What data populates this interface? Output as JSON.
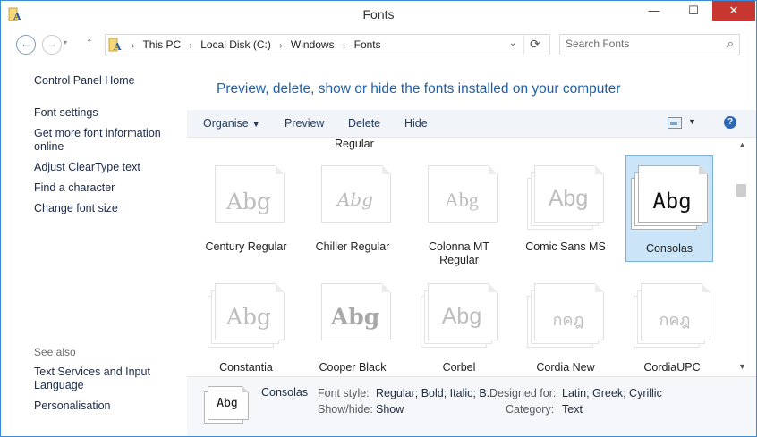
{
  "window": {
    "title": "Fonts",
    "min": "—",
    "max": "☐",
    "close": "✕"
  },
  "nav": {
    "back": "←",
    "forward": "→",
    "up": "↑",
    "history": "▾"
  },
  "address": {
    "crumbs": [
      "This PC",
      "Local Disk (C:)",
      "Windows",
      "Fonts"
    ],
    "separator": "›",
    "dropdown": "⌄",
    "refresh": "⟳"
  },
  "search": {
    "placeholder": "Search Fonts",
    "icon": "⌕"
  },
  "sidebar": {
    "links": [
      "Control Panel Home",
      "Font settings",
      "Get more font information online",
      "Adjust ClearType text",
      "Find a character",
      "Change font size"
    ],
    "see_also": "See also",
    "see_also_links": [
      "Text Services and Input Language",
      "Personalisation"
    ]
  },
  "heading": "Preview, delete, show or hide the fonts installed on your computer",
  "toolbar": {
    "organise": "Organise",
    "preview": "Preview",
    "delete": "Delete",
    "hide": "Hide",
    "caret": "▼",
    "help": "?"
  },
  "partial_label": "Regular",
  "fonts_row1": [
    {
      "name": "Century Regular",
      "sample": "Abg"
    },
    {
      "name": "Chiller Regular",
      "sample": "Abg"
    },
    {
      "name": "Colonna MT Regular",
      "sample": "Abg"
    },
    {
      "name": "Comic Sans MS",
      "sample": "Abg"
    },
    {
      "name": "Consolas",
      "sample": "Abg"
    }
  ],
  "fonts_row2": [
    {
      "name": "Constantia",
      "sample": "Abg"
    },
    {
      "name": "Cooper Black",
      "sample": "Abg"
    },
    {
      "name": "Corbel",
      "sample": "Abg"
    },
    {
      "name": "Cordia New",
      "sample": "กคฎ"
    },
    {
      "name": "CordiaUPC",
      "sample": "กคฎ"
    }
  ],
  "details": {
    "name": "Consolas",
    "sample": "Abg",
    "font_style_label": "Font style:",
    "font_style": "Regular; Bold; Italic; B...",
    "show_hide_label": "Show/hide:",
    "show_hide": "Show",
    "designed_for_label": "Designed for:",
    "designed_for": "Latin; Greek; Cyrillic",
    "category_label": "Category:",
    "category": "Text"
  },
  "scroll": {
    "up": "▲",
    "down": "▼"
  },
  "colors": {
    "accent": "#1f5fa8",
    "selection": "#cce4f7",
    "close": "#c7372f"
  }
}
